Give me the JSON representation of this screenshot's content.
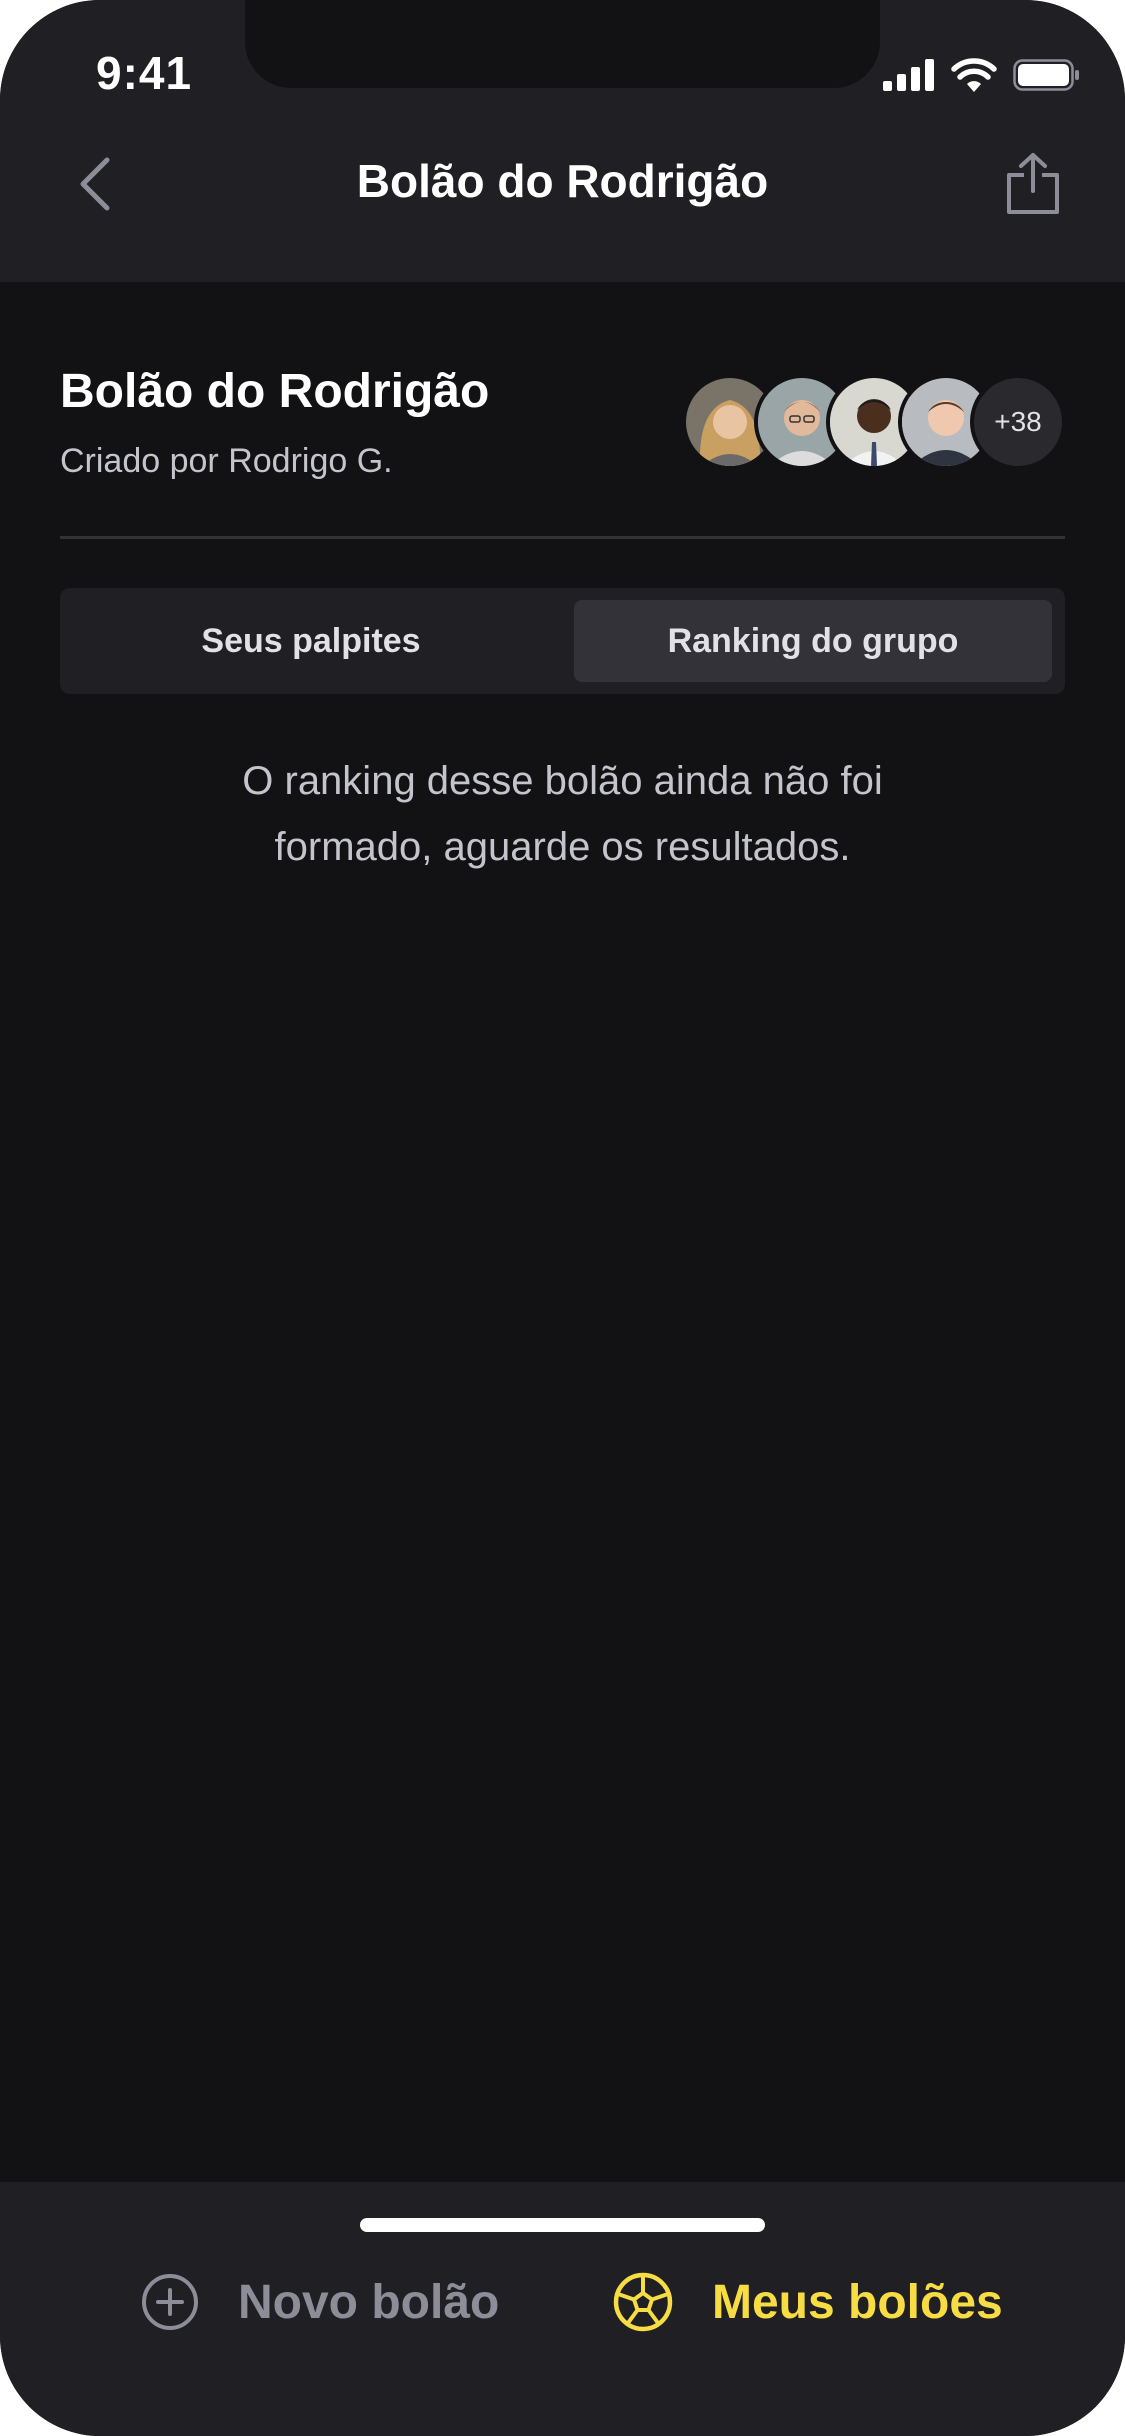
{
  "status_bar": {
    "time": "9:41",
    "icons": [
      "signal-icon",
      "wifi-icon",
      "battery-icon"
    ]
  },
  "nav": {
    "title": "Bolão do Rodrigão",
    "back_icon": "chevron-left-icon",
    "share_icon": "share-icon"
  },
  "group": {
    "title": "Bolão do Rodrigão",
    "created_by": "Criado por Rodrigo G.",
    "participants_more": "+38"
  },
  "tabs": [
    {
      "label": "Seus palpites",
      "active": false
    },
    {
      "label": "Ranking do grupo",
      "active": true
    }
  ],
  "empty_message": "O ranking desse bolão ainda não foi formado, aguarde os resultados.",
  "bottom_nav": {
    "new_label": "Novo bolão",
    "new_icon": "plus-circle-icon",
    "mine_label": "Meus bolões",
    "mine_icon": "soccer-ball-icon"
  },
  "colors": {
    "background": "#121214",
    "surface": "#202024",
    "accent": "#F7DD43",
    "muted": "#8D8D99"
  }
}
